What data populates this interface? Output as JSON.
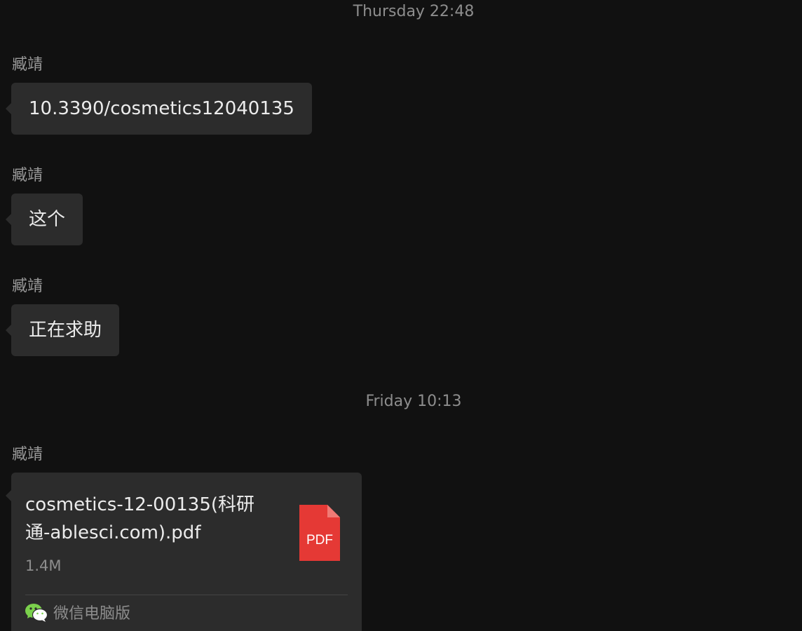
{
  "messages": {
    "timestamp_1": "Thursday 22:48",
    "timestamp_2": "Friday 10:13",
    "sender_name": "臧靖",
    "msg_1": "10.3390/cosmetics12040135",
    "msg_2": "这个",
    "msg_3": "正在求助",
    "file": {
      "name": "cosmetics-12-00135(科研通-ablesci.com).pdf",
      "size": "1.4M",
      "type_label": "PDF",
      "source_label": "微信电脑版",
      "source_icon": "wechat-icon",
      "file_icon": "pdf-file-icon"
    }
  },
  "colors": {
    "background": "#111111",
    "bubble": "#2c2c2c",
    "pdf_red": "#e53935",
    "wechat_green": "#7bd14c"
  }
}
